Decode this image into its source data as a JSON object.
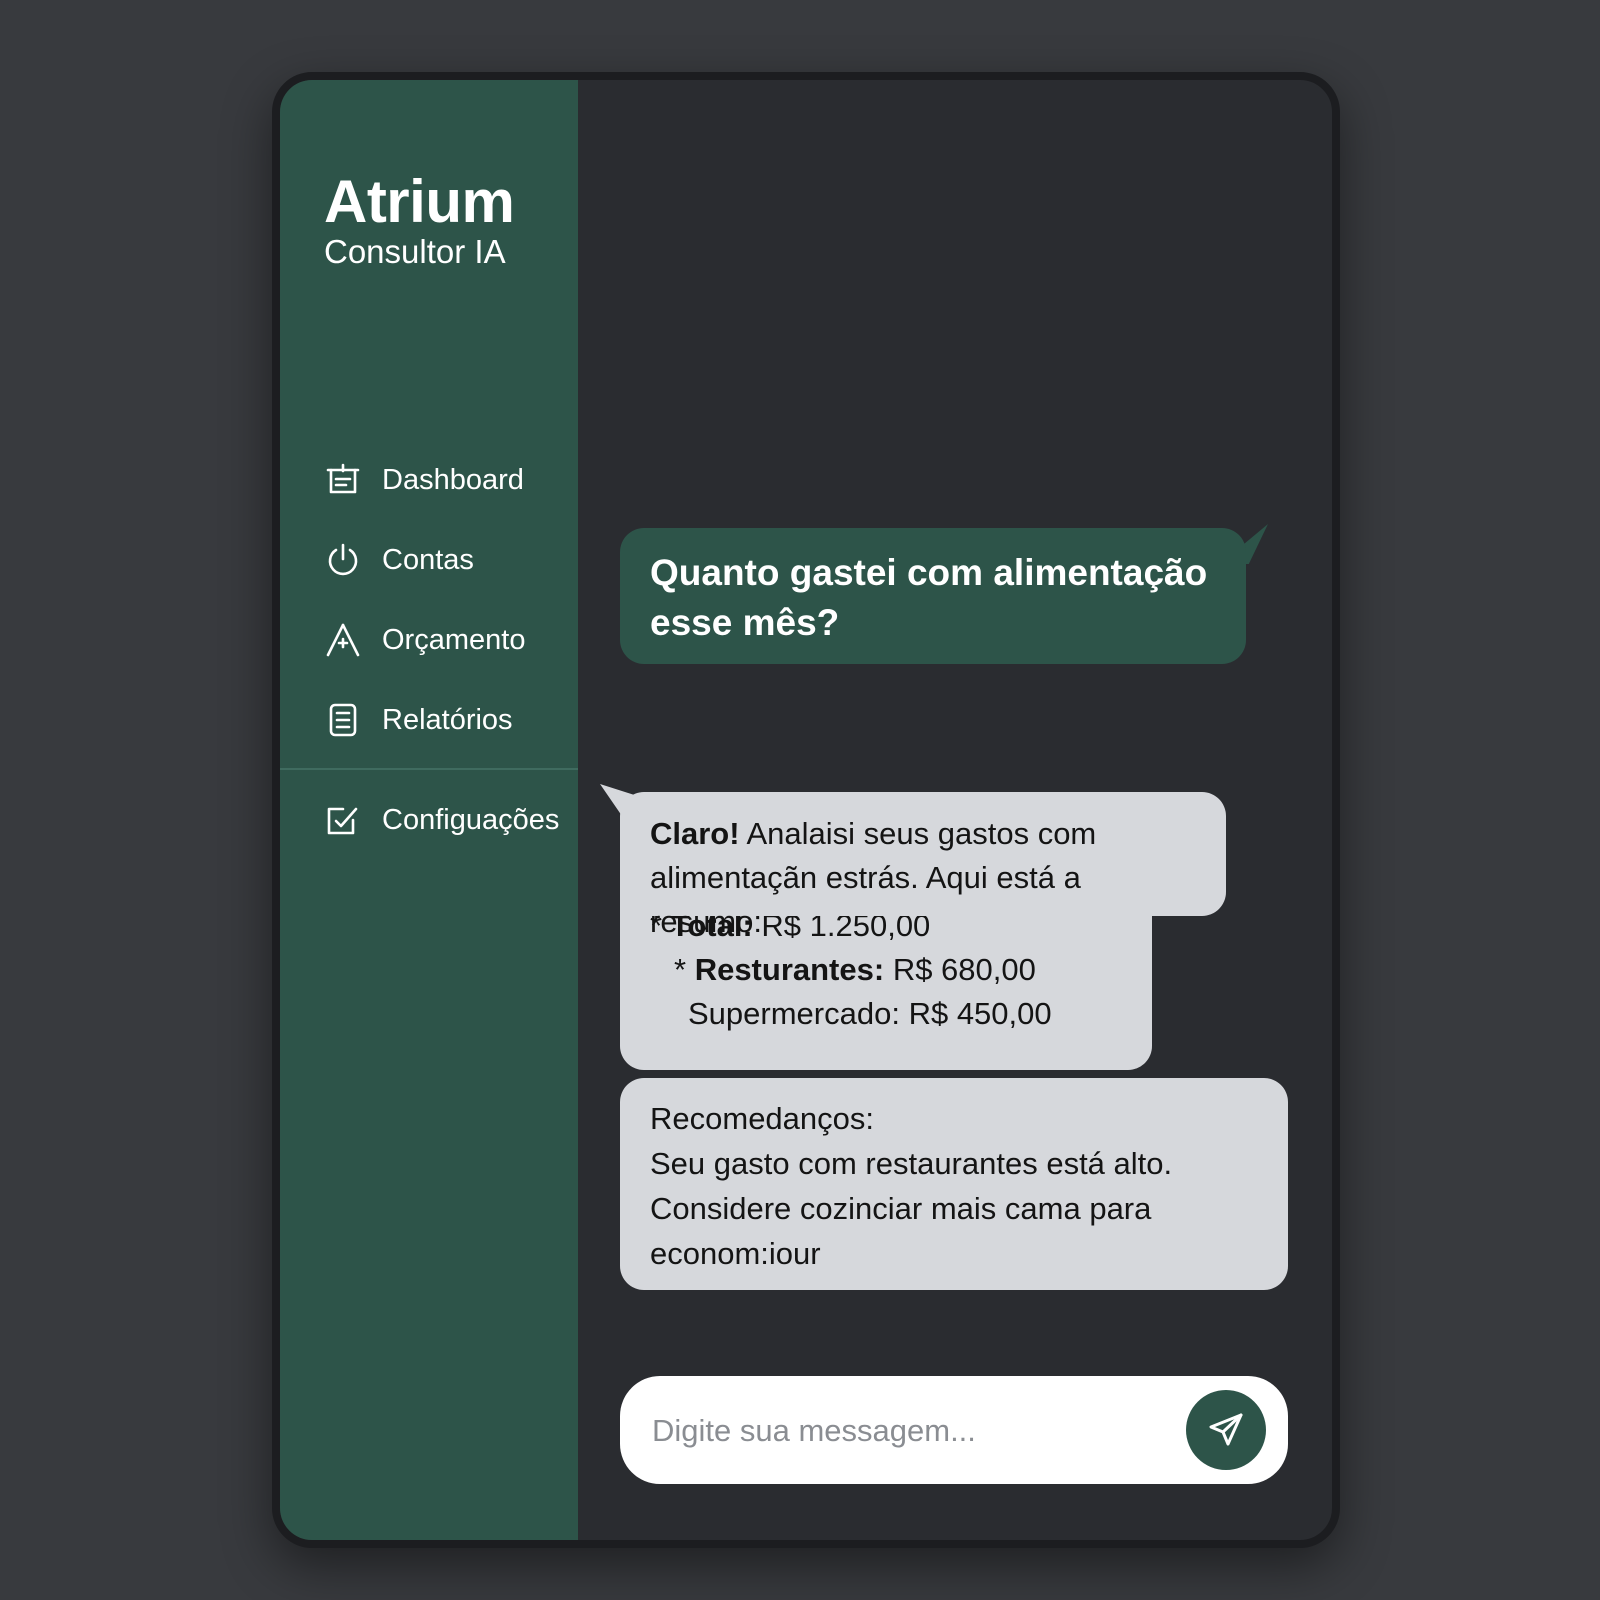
{
  "brand": {
    "name": "Atrium",
    "subtitle": "Consultor IA"
  },
  "sidebar": {
    "items": [
      {
        "label": "Dashboard",
        "icon": "dashboard-icon"
      },
      {
        "label": "Contas",
        "icon": "power-icon"
      },
      {
        "label": "Orçamento",
        "icon": "triangle-icon"
      },
      {
        "label": "Relatórios",
        "icon": "report-icon"
      },
      {
        "label": "Configuações",
        "icon": "edit-check-icon"
      }
    ]
  },
  "chat": {
    "user_message": "Quanto gastei com alimentação esse mês?",
    "ai_intro_bold": "Claro!",
    "ai_intro_line1": " Analaisi seus gastos com",
    "ai_intro_line2": "alimentaçãn estrás. Aqui está a resumo:",
    "summary": {
      "total": {
        "label": "Total:",
        "value": "R$ 1.250,00"
      },
      "restaurantes": {
        "label": "Resturantes:",
        "value": "R$ 680,00"
      },
      "supermercado": {
        "label": "Supermercado:",
        "value": "R$ 450,00"
      }
    },
    "recommendation": {
      "title": "Recomedanços:",
      "line1": "Seu gasto com restaurantes está alto.",
      "line2": "Considere cozinciar mais cama para",
      "line3": "econom:iour"
    }
  },
  "composer": {
    "placeholder": "Digite sua messagem..."
  },
  "colors": {
    "accent": "#2d5449",
    "background": "#383a3e",
    "panel": "#2a2c30",
    "bubble_ai": "#d6d8dc"
  }
}
